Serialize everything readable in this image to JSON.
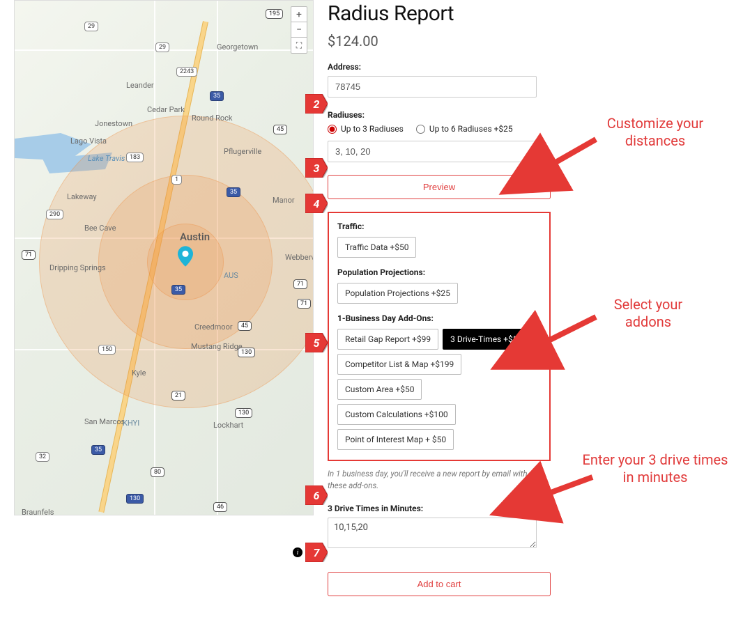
{
  "page": {
    "title": "Radius Report",
    "price": "$124.00"
  },
  "address": {
    "label": "Address:",
    "value": "78745"
  },
  "radiuses": {
    "label": "Radiuses:",
    "opt1": "Up to 3 Radiuses",
    "opt2": "Up to 6 Radiuses +$25",
    "value": "3, 10, 20"
  },
  "preview": {
    "label": "Preview"
  },
  "traffic": {
    "label": "Traffic:",
    "chip": "Traffic Data +$50"
  },
  "population": {
    "label": "Population Projections:",
    "chip": "Population Projections +$25"
  },
  "addons": {
    "label": "1-Business Day Add-Ons:",
    "chips": {
      "a": "Retail Gap Report +$99",
      "b": "3 Drive-Times +$50",
      "c": "Competitor List & Map +$199",
      "d": "Custom Area +$50",
      "e": "Custom Calculations +$100",
      "f": "Point of Interest Map + $50"
    }
  },
  "help": "In 1 business day, you'll receive a new report by email with these add-ons.",
  "drivetimes": {
    "label": "3 Drive Times in Minutes:",
    "value": "10,15,20"
  },
  "cart": {
    "label": "Add to cart"
  },
  "steps": {
    "s2": "2",
    "s3": "3",
    "s4": "4",
    "s5": "5",
    "s6": "6",
    "s7": "7"
  },
  "annotations": {
    "a1": "Customize your distances",
    "a2": "Select your addons",
    "a3": "Enter your 3 drive times in minutes"
  },
  "map": {
    "zoom_in": "+",
    "zoom_out": "−",
    "fullscreen": "⛶",
    "labels": {
      "austin": "Austin",
      "georgetown": "Georgetown",
      "roundrock": "Round Rock",
      "pflugerville": "Pflugerville",
      "leander": "Leander",
      "cedarpark": "Cedar Park",
      "jonestown": "Jonestown",
      "lagovista": "Lago Vista",
      "laketravis": "Lake Travis",
      "lakeway": "Lakeway",
      "beecave": "Bee Cave",
      "manor": "Manor",
      "webberville": "Webberville",
      "dripping": "Dripping Springs",
      "creedmoor": "Creedmoor",
      "mustang": "Mustang Ridge",
      "kyle": "Kyle",
      "sanmarcos": "San Marcos",
      "lockhart": "Lockhart",
      "braunfels": "Braunfels",
      "khyi": "KHYI",
      "aus": "AUS"
    },
    "routes": {
      "r29a": "29",
      "r29b": "29",
      "r195": "195",
      "r2243": "2243",
      "r183": "183",
      "r35a": "35",
      "r35b": "35",
      "r35c": "35",
      "r35d": "35",
      "r130a": "130",
      "r130b": "130",
      "r71a": "71",
      "r71b": "71",
      "r71c": "71",
      "r290": "290",
      "r21": "21",
      "r45a": "45",
      "r45b": "45",
      "r1": "1",
      "r150": "150",
      "r32": "32",
      "r80": "80",
      "r46": "46"
    }
  }
}
